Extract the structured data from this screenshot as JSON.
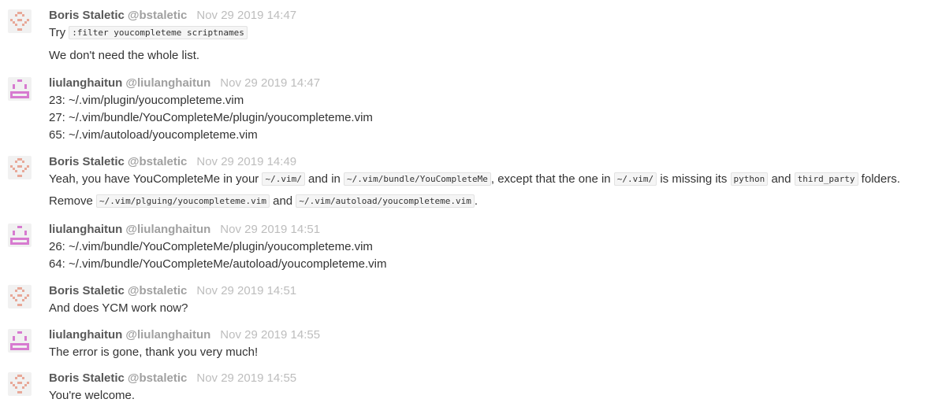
{
  "colors": {
    "name": "#595959",
    "handle": "#a0a0a0",
    "time": "#bdbdbd",
    "text": "#333333",
    "code_bg": "#f5f5f5",
    "avatar_boris": "#e8a898",
    "avatar_liu": "#d77bd0"
  },
  "messages": [
    {
      "avatar": "boris-identicon",
      "name": "Boris Staletic",
      "handle": "@bstaletic",
      "time": "Nov 29 2019 14:47",
      "lines": [
        {
          "t1": "Try ",
          "c1": ":filter youcompleteme scriptnames"
        },
        {
          "t1": "We don't need the whole list."
        }
      ]
    },
    {
      "avatar": "liulanghaitun-identicon",
      "name": "liulanghaitun",
      "handle": "@liulanghaitun",
      "time": "Nov 29 2019 14:47",
      "lines": [
        {
          "t1": "23: ~/.vim/plugin/youcompleteme.vim"
        },
        {
          "t1": "27: ~/.vim/bundle/YouCompleteMe/plugin/youcompleteme.vim"
        },
        {
          "t1": "65: ~/.vim/autoload/youcompleteme.vim"
        }
      ]
    },
    {
      "avatar": "boris-identicon",
      "name": "Boris Staletic",
      "handle": "@bstaletic",
      "time": "Nov 29 2019 14:49",
      "lines": [
        {
          "t1": "Yeah, you have YouCompleteMe in your ",
          "c1": "~/.vim/",
          "t2": " and in ",
          "c2": "~/.vim/bundle/YouCompleteMe",
          "t3": ", except that the one in ",
          "c3": "~/.vim/",
          "t4": " is missing its ",
          "c4": "python",
          "t5": " and ",
          "c5": "third_party",
          "t6": " folders."
        },
        {
          "t1": "Remove ",
          "c1": "~/.vim/plguing/youcompleteme.vim",
          "t2": " and ",
          "c2": "~/.vim/autoload/youcompleteme.vim",
          "t3": "."
        }
      ]
    },
    {
      "avatar": "liulanghaitun-identicon",
      "name": "liulanghaitun",
      "handle": "@liulanghaitun",
      "time": "Nov 29 2019 14:51",
      "lines": [
        {
          "t1": "26: ~/.vim/bundle/YouCompleteMe/plugin/youcompleteme.vim"
        },
        {
          "t1": "64: ~/.vim/bundle/YouCompleteMe/autoload/youcompleteme.vim"
        }
      ]
    },
    {
      "avatar": "boris-identicon",
      "name": "Boris Staletic",
      "handle": "@bstaletic",
      "time": "Nov 29 2019 14:51",
      "lines": [
        {
          "t1": "And does YCM work now?"
        }
      ]
    },
    {
      "avatar": "liulanghaitun-identicon",
      "name": "liulanghaitun",
      "handle": "@liulanghaitun",
      "time": "Nov 29 2019 14:55",
      "lines": [
        {
          "t1": "The error is gone, thank you very much!"
        }
      ]
    },
    {
      "avatar": "boris-identicon",
      "name": "Boris Staletic",
      "handle": "@bstaletic",
      "time": "Nov 29 2019 14:55",
      "lines": [
        {
          "t1": "You're welcome."
        }
      ]
    }
  ]
}
